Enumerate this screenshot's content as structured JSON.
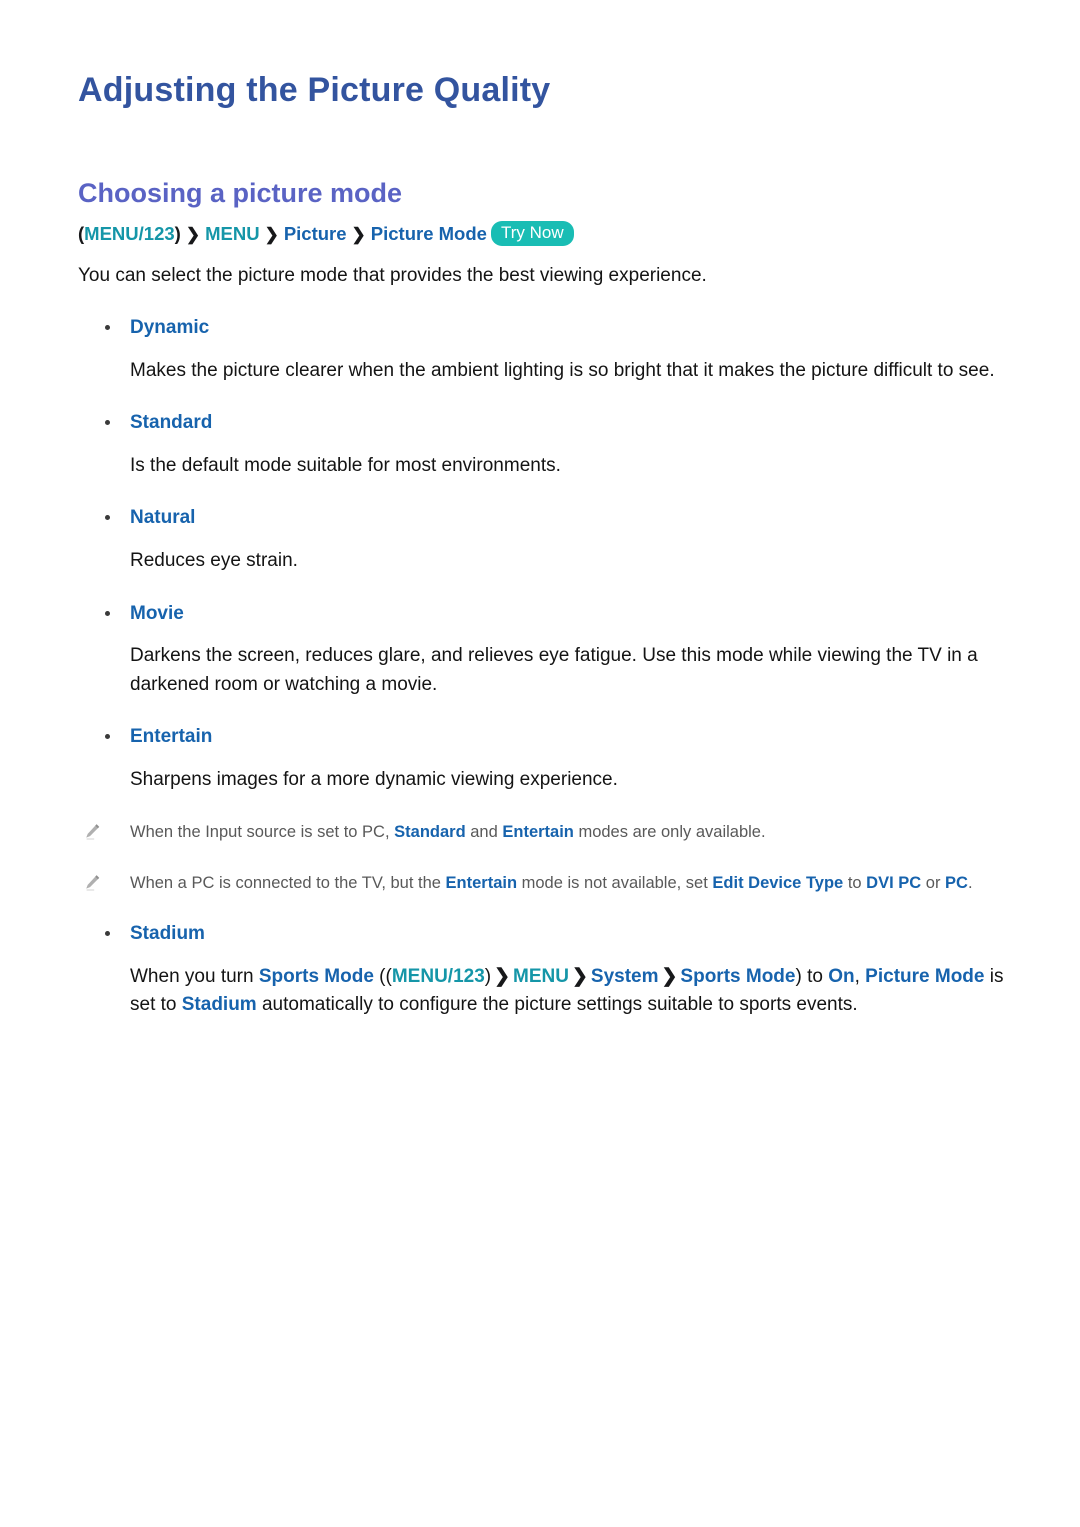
{
  "document": {
    "title": "Adjusting the Picture Quality",
    "section_title": "Choosing a picture mode"
  },
  "breadcrumb": {
    "open_paren": "(",
    "menu123": "MENU/123",
    "close_paren": ")",
    "arrow": "❯",
    "menu": "MENU",
    "picture": "Picture",
    "picture_mode": "Picture Mode",
    "try_now_badge": "Try Now"
  },
  "intro": "You can select the picture mode that provides the best viewing experience.",
  "modes": [
    {
      "name": "Dynamic",
      "description": "Makes the picture clearer when the ambient lighting is so bright that it makes the picture difficult to see."
    },
    {
      "name": "Standard",
      "description": "Is the default mode suitable for most environments."
    },
    {
      "name": "Natural",
      "description": "Reduces eye strain."
    },
    {
      "name": "Movie",
      "description": "Darkens the screen, reduces glare, and relieves eye fatigue. Use this mode while viewing the TV in a darkened room or watching a movie."
    },
    {
      "name": "Entertain",
      "description": "Sharpens images for a more dynamic viewing experience."
    }
  ],
  "notes": [
    {
      "icon": "pencil-icon",
      "parts": [
        {
          "text": "When the Input source is set to PC, ",
          "style": "plain"
        },
        {
          "text": "Standard",
          "style": "highlight"
        },
        {
          "text": " and ",
          "style": "plain"
        },
        {
          "text": "Entertain",
          "style": "highlight"
        },
        {
          "text": " modes are only available.",
          "style": "plain"
        }
      ]
    },
    {
      "icon": "pencil-icon",
      "parts": [
        {
          "text": "When a PC is connected to the TV, but the ",
          "style": "plain"
        },
        {
          "text": "Entertain",
          "style": "highlight"
        },
        {
          "text": " mode is not available, set ",
          "style": "plain"
        },
        {
          "text": "Edit Device Type",
          "style": "highlight"
        },
        {
          "text": " to ",
          "style": "plain"
        },
        {
          "text": "DVI PC",
          "style": "highlight"
        },
        {
          "text": " or ",
          "style": "plain"
        },
        {
          "text": "PC",
          "style": "highlight"
        },
        {
          "text": ".",
          "style": "plain"
        }
      ]
    }
  ],
  "stadium": {
    "name": "Stadium",
    "parts": [
      {
        "text": "When you turn ",
        "style": "plain"
      },
      {
        "text": "Sports Mode",
        "style": "blue"
      },
      {
        "text": " ((",
        "style": "plain"
      },
      {
        "text": "MENU/123",
        "style": "teal"
      },
      {
        "text": ")",
        "style": "plain"
      },
      {
        "text": "❯",
        "style": "arrow"
      },
      {
        "text": "MENU",
        "style": "teal"
      },
      {
        "text": "❯",
        "style": "arrow"
      },
      {
        "text": "System",
        "style": "blue"
      },
      {
        "text": "❯",
        "style": "arrow"
      },
      {
        "text": "Sports Mode",
        "style": "blue"
      },
      {
        "text": ") to ",
        "style": "plain"
      },
      {
        "text": "On",
        "style": "blue"
      },
      {
        "text": ", ",
        "style": "plain"
      },
      {
        "text": "Picture Mode",
        "style": "blue"
      },
      {
        "text": " is set to ",
        "style": "plain"
      },
      {
        "text": "Stadium",
        "style": "blue"
      },
      {
        "text": " automatically to configure the picture settings suitable to sports events.",
        "style": "plain"
      }
    ]
  },
  "colors": {
    "title": "#33549f",
    "section_title": "#5a63c4",
    "link_blue": "#1763ad",
    "menu_teal": "#1596a8",
    "badge_bg": "#19bdb4",
    "body_text": "#141414",
    "note_text": "#595959"
  }
}
